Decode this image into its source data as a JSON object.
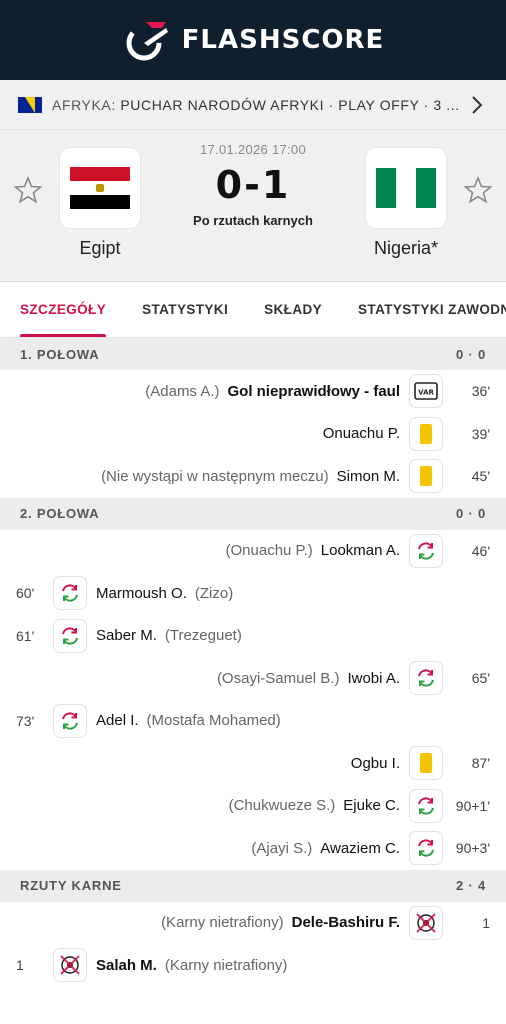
{
  "header": {
    "brand": "FLASHSCORE"
  },
  "competition": {
    "region": "AFRYKA:",
    "name": "PUCHAR NARODÓW AFRYKI · PLAY OFFY · 3 ..."
  },
  "match": {
    "datetime": "17.01.2026 17:00",
    "score": "0-1",
    "status": "Po rzutach karnych",
    "home": {
      "name": "Egipt",
      "flag_colors": [
        "#ce1126",
        "#ffffff",
        "#000000"
      ]
    },
    "away": {
      "name": "Nigeria*",
      "flag_colors": [
        "#008751",
        "#ffffff",
        "#008751"
      ]
    }
  },
  "tabs": [
    "SZCZEGÓŁY",
    "STATYSTYKI",
    "SKŁADY",
    "STATYSTYKI ZAWODNIKÓW"
  ],
  "sections": [
    {
      "title": "1. POŁOWA",
      "score": "0 · 0",
      "events": [
        {
          "side": "away",
          "minute": "36'",
          "icon": "var-icon",
          "main": "Gol nieprawidłowy - faul",
          "main_bold": true,
          "note": "(Adams A.)"
        },
        {
          "side": "away",
          "minute": "39'",
          "icon": "yellow-card-icon",
          "main": "Onuachu P.",
          "note": ""
        },
        {
          "side": "away",
          "minute": "45'",
          "icon": "yellow-card-icon",
          "main": "Simon M.",
          "note": "(Nie wystąpi w następnym meczu)"
        }
      ]
    },
    {
      "title": "2. POŁOWA",
      "score": "0 · 0",
      "events": [
        {
          "side": "away",
          "minute": "46'",
          "icon": "substitution-icon",
          "main": "Lookman A.",
          "note": "(Onuachu P.)"
        },
        {
          "side": "home",
          "minute": "60'",
          "icon": "substitution-icon",
          "main": "Marmoush O.",
          "note": "(Zizo)"
        },
        {
          "side": "home",
          "minute": "61'",
          "icon": "substitution-icon",
          "main": "Saber M.",
          "note": "(Trezeguet)"
        },
        {
          "side": "away",
          "minute": "65'",
          "icon": "substitution-icon",
          "main": "Iwobi A.",
          "note": "(Osayi-Samuel B.)"
        },
        {
          "side": "home",
          "minute": "73'",
          "icon": "substitution-icon",
          "main": "Adel I.",
          "note": "(Mostafa Mohamed)"
        },
        {
          "side": "away",
          "minute": "87'",
          "icon": "yellow-card-icon",
          "main": "Ogbu I.",
          "note": ""
        },
        {
          "side": "away",
          "minute": "90+1'",
          "icon": "substitution-icon",
          "main": "Ejuke C.",
          "note": "(Chukwueze S.)"
        },
        {
          "side": "away",
          "minute": "90+3'",
          "icon": "substitution-icon",
          "main": "Awaziem C.",
          "note": "(Ajayi S.)"
        }
      ]
    },
    {
      "title": "RZUTY KARNE",
      "score": "2 · 4",
      "events": [
        {
          "side": "away",
          "minute": "1",
          "icon": "missed-penalty-icon",
          "main": "Dele-Bashiru F.",
          "main_bold": true,
          "note": "(Karny nietrafiony)"
        },
        {
          "side": "home",
          "minute": "1",
          "icon": "missed-penalty-icon",
          "main": "Salah M.",
          "main_bold": true,
          "note": "(Karny nietrafiony)"
        }
      ]
    }
  ],
  "colors": {
    "accent": "#d0144a",
    "header_bg": "#0f1f2e",
    "yellow_card": "#f5c400",
    "sub_in": "#2ea043",
    "sub_out": "#d0144a"
  }
}
